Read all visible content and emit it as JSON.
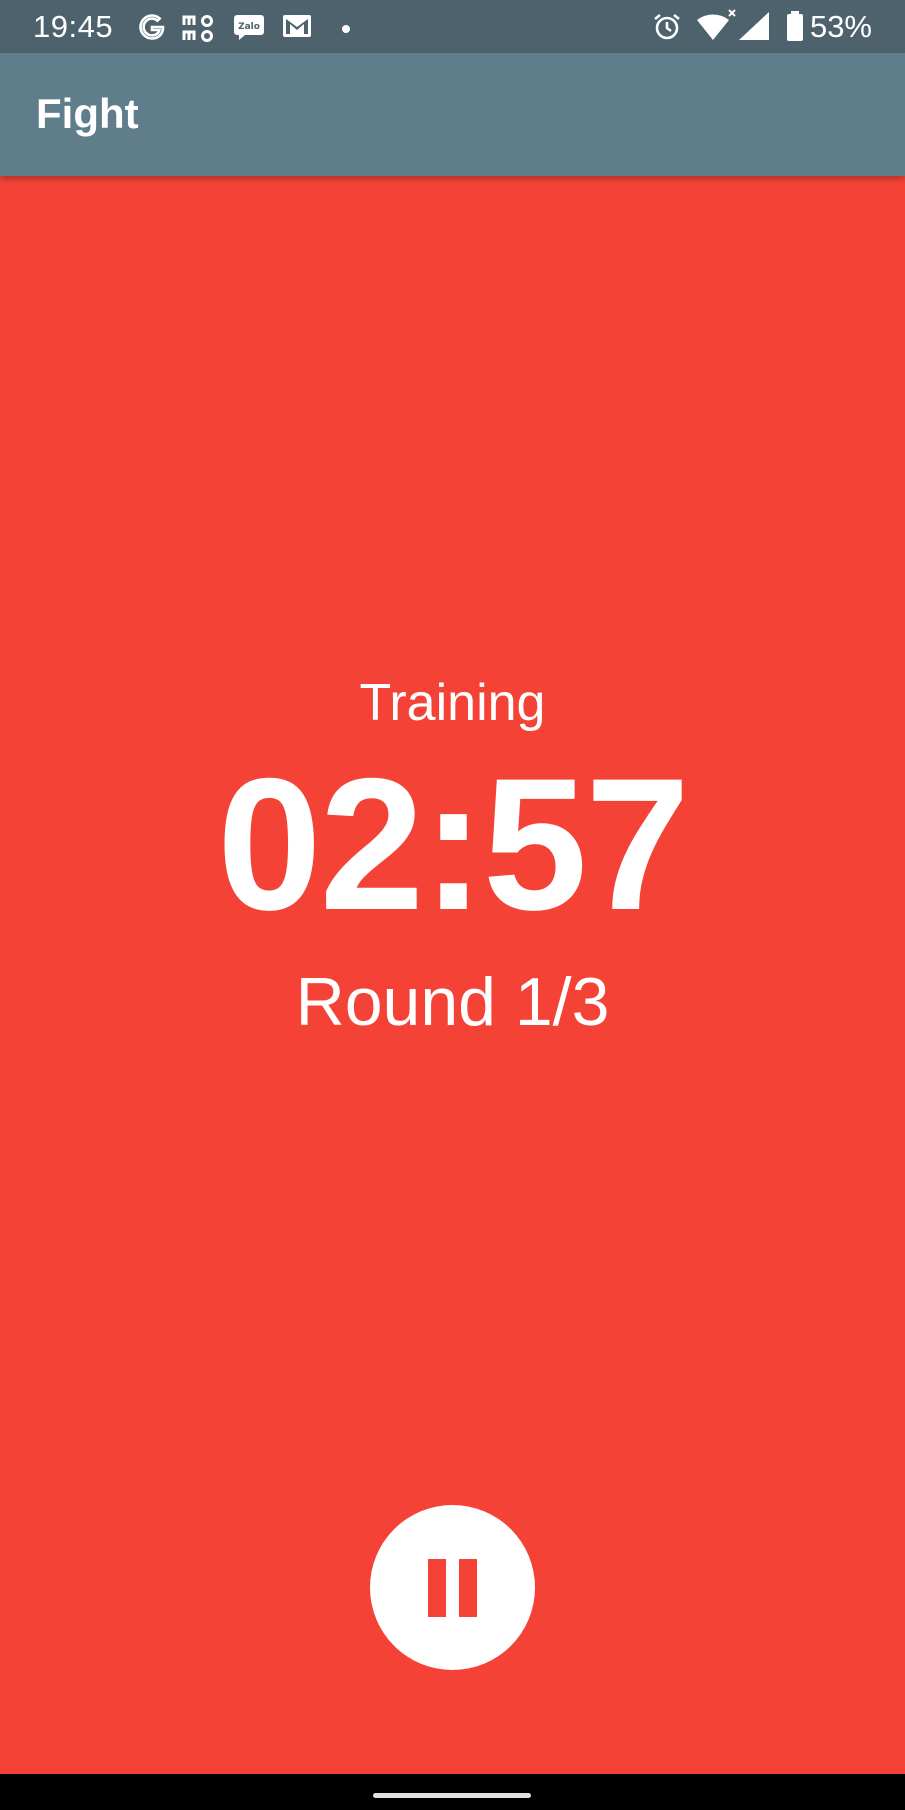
{
  "status_bar": {
    "time": "19:45",
    "notification_icons": [
      "google-icon",
      "momo-icon",
      "zalo-icon",
      "gmail-icon",
      "dot-icon"
    ],
    "system_icons": [
      "alarm-icon",
      "wifi-icon",
      "signal-icon",
      "battery-icon"
    ],
    "battery_percent": "53%"
  },
  "app_bar": {
    "title": "Fight",
    "color": "#607d8b"
  },
  "timer_screen": {
    "background_color": "#f44336",
    "phase_label": "Training",
    "time_remaining": "02:57",
    "round_label": "Round 1/3",
    "pause_button_icon": "pause-icon"
  }
}
